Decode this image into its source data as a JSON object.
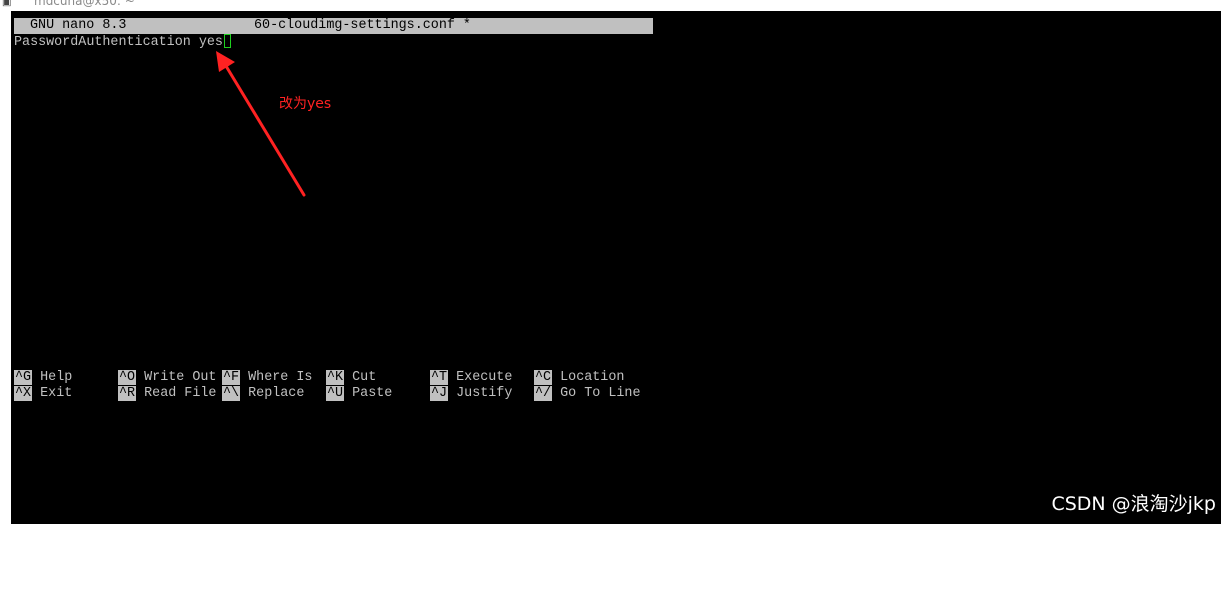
{
  "window": {
    "title": "mdcuna@x50: ~",
    "icon": "terminal-app-icon"
  },
  "nano": {
    "header": {
      "app": "GNU nano 8.3",
      "filename": "60-cloudimg-settings.conf *"
    },
    "content": {
      "line1": "PasswordAuthentication yes"
    },
    "shortcuts": [
      {
        "key": "^G",
        "label": "Help"
      },
      {
        "key": "^O",
        "label": "Write Out"
      },
      {
        "key": "^F",
        "label": "Where Is"
      },
      {
        "key": "^K",
        "label": "Cut"
      },
      {
        "key": "^T",
        "label": "Execute"
      },
      {
        "key": "^C",
        "label": "Location"
      },
      {
        "key": "^X",
        "label": "Exit"
      },
      {
        "key": "^R",
        "label": "Read File"
      },
      {
        "key": "^\\",
        "label": "Replace"
      },
      {
        "key": "^U",
        "label": "Paste"
      },
      {
        "key": "^J",
        "label": "Justify"
      },
      {
        "key": "^/",
        "label": "Go To Line"
      }
    ]
  },
  "annotation": {
    "text": "改为yes",
    "color": "#ff2222"
  },
  "watermark": "CSDN @浪淘沙jkp",
  "colors": {
    "terminal_bg": "#000000",
    "terminal_fg": "#c0c0c0",
    "cursor": "#1fd11f"
  }
}
